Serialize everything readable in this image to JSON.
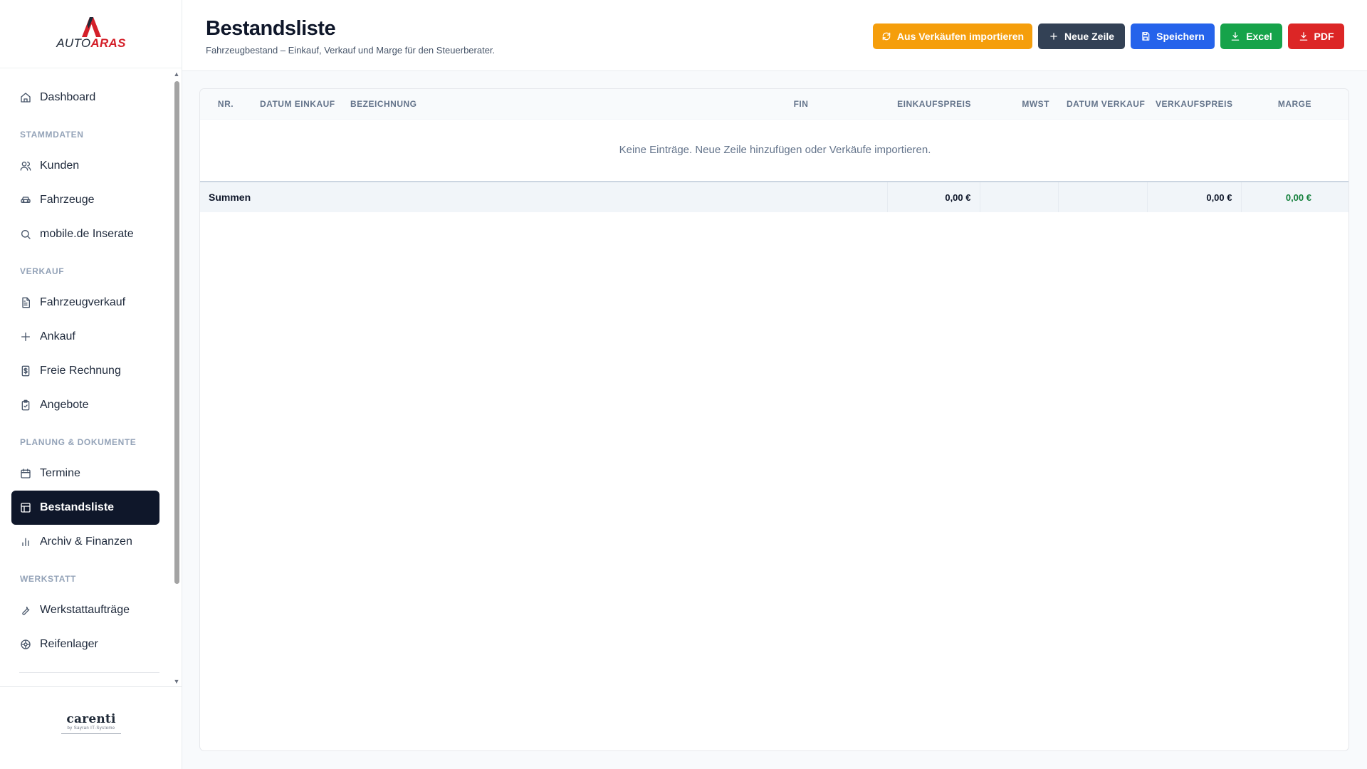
{
  "brand": {
    "logo_part1": "AUTO",
    "logo_part2": "ARAS",
    "logo_icon": "autoaras-a-logo-icon",
    "footer_logo": "carenti",
    "footer_tagline": "by Sayran IT-Systeme"
  },
  "sidebar": {
    "top_items": [
      {
        "label": "Dashboard",
        "icon": "home-icon"
      }
    ],
    "sections": [
      {
        "title": "STAMMDATEN",
        "items": [
          {
            "label": "Kunden",
            "icon": "users-icon"
          },
          {
            "label": "Fahrzeuge",
            "icon": "car-icon"
          },
          {
            "label": "mobile.de Inserate",
            "icon": "search-icon"
          }
        ]
      },
      {
        "title": "VERKAUF",
        "items": [
          {
            "label": "Fahrzeugverkauf",
            "icon": "file-text-icon"
          },
          {
            "label": "Ankauf",
            "icon": "plus-icon"
          },
          {
            "label": "Freie Rechnung",
            "icon": "receipt-icon"
          },
          {
            "label": "Angebote",
            "icon": "clipboard-icon"
          }
        ]
      },
      {
        "title": "PLANUNG & DOKUMENTE",
        "items": [
          {
            "label": "Termine",
            "icon": "calendar-icon"
          },
          {
            "label": "Bestandsliste",
            "icon": "table-icon",
            "active": true
          },
          {
            "label": "Archiv & Finanzen",
            "icon": "bar-chart-icon"
          }
        ]
      },
      {
        "title": "WERKSTATT",
        "items": [
          {
            "label": "Werkstattaufträge",
            "icon": "wrench-icon"
          },
          {
            "label": "Reifenlager",
            "icon": "tire-icon"
          }
        ]
      }
    ]
  },
  "header": {
    "title": "Bestandsliste",
    "subtitle": "Fahrzeugbestand – Einkauf, Verkauf und Marge für den Steuerberater."
  },
  "actions": [
    {
      "label": "Aus Verkäufen importieren",
      "icon": "refresh-icon",
      "color": "#f59e0b"
    },
    {
      "label": "Neue Zeile",
      "icon": "plus-icon",
      "color": "#334155"
    },
    {
      "label": "Speichern",
      "icon": "save-icon",
      "color": "#2563eb"
    },
    {
      "label": "Excel",
      "icon": "download-icon",
      "color": "#16a34a"
    },
    {
      "label": "PDF",
      "icon": "download-icon",
      "color": "#dc2626"
    }
  ],
  "table": {
    "columns": [
      "NR.",
      "DATUM EINKAUF",
      "BEZEICHNUNG",
      "FIN",
      "EINKAUFSPREIS",
      "MWST",
      "DATUM VERKAUF",
      "VERKAUFSPREIS",
      "MARGE"
    ],
    "rows": [],
    "empty_message": "Keine Einträge. Neue Zeile hinzufügen oder Verkäufe importieren.",
    "totals": {
      "label": "Summen",
      "einkaufspreis": "0,00 €",
      "verkaufspreis": "0,00 €",
      "marge": "0,00 €"
    }
  },
  "colors": {
    "active_nav": "#0f172a",
    "brand_red": "#d4202a",
    "marge_positive": "#15803d"
  }
}
